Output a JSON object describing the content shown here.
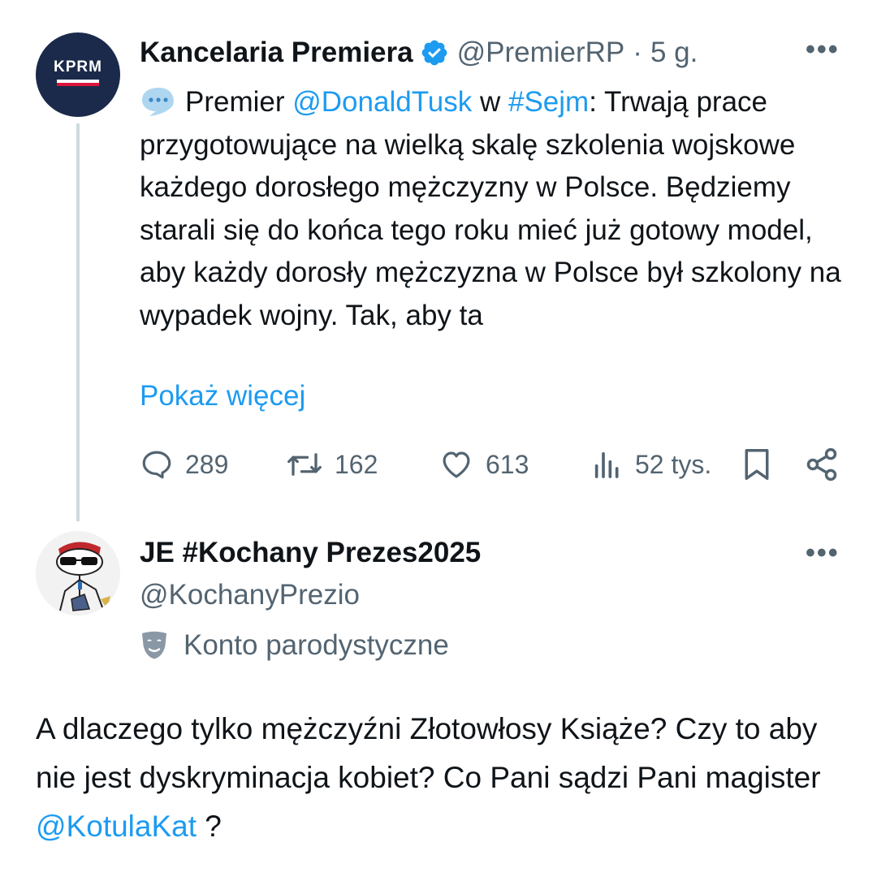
{
  "tweet": {
    "author_name": "Kancelaria Premiera",
    "handle": "@PremierRP",
    "separator": "·",
    "time": "5 g.",
    "avatar_text": "KPRM",
    "text_parts": {
      "prefix": "Premier ",
      "mention": "@DonaldTusk",
      "mid": " w ",
      "hashtag": "#Sejm",
      "body": ": Trwają prace przygotowujące na wielką skalę szkolenia wojskowe każdego dorosłego mężczyzny w Polsce. Będziemy starali się do końca tego roku mieć już gotowy model, aby każdy dorosły mężczyzna w Polsce był szkolony na wypadek wojny. Tak, aby ta"
    },
    "show_more": "Pokaż więcej",
    "stats": {
      "replies": "289",
      "reposts": "162",
      "likes": "613",
      "views": "52 tys."
    }
  },
  "reply": {
    "author_name": "JE #Kochany Prezes2025",
    "handle": "@KochanyPrezio",
    "parody_label": "Konto parodystyczne",
    "text_parts": {
      "body": "A dlaczego tylko mężczyźni Złotowłosy Książe? Czy to aby nie jest dyskryminacja kobiet? Co Pani sądzi Pani magister ",
      "mention": "@KotulaKat",
      "suffix": " ?"
    }
  },
  "icons": {
    "verified": "verified-badge-icon",
    "more": "more-icon",
    "speech": "speech-bubble-icon",
    "reply": "reply-icon",
    "repost": "repost-icon",
    "like": "heart-icon",
    "views": "views-icon",
    "bookmark": "bookmark-icon",
    "share": "share-icon",
    "parody": "theater-mask-icon"
  },
  "colors": {
    "link": "#1d9bf0",
    "muted": "#536471",
    "text": "#0f1419"
  }
}
